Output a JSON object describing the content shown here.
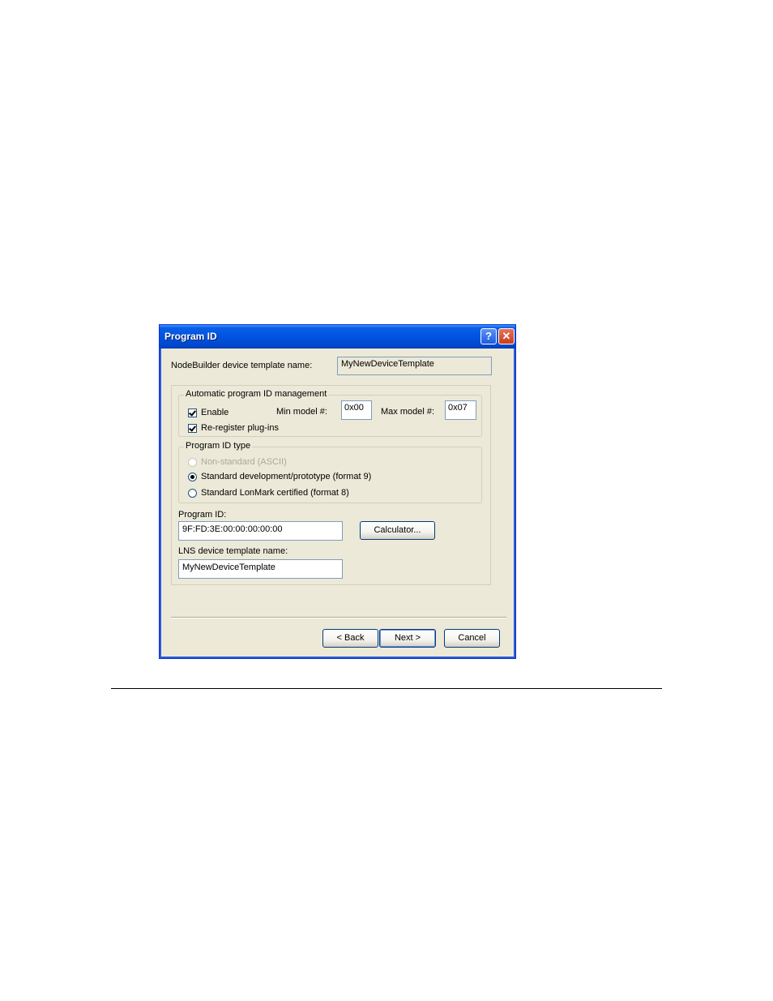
{
  "window": {
    "title": "Program ID",
    "help_glyph": "?",
    "close_glyph": "✕"
  },
  "form": {
    "nodebuilder_label": "NodeBuilder device template name:",
    "nodebuilder_value": "MyNewDeviceTemplate",
    "auto_group": {
      "title": "Automatic program ID management",
      "enable_label": "Enable",
      "enable_checked": true,
      "min_model_label": "Min model #:",
      "min_model_value": "0x00",
      "max_model_label": "Max model #:",
      "max_model_value": "0x07",
      "reregister_label": "Re-register plug-ins",
      "reregister_checked": true
    },
    "type_group": {
      "title": "Program ID type",
      "options": [
        {
          "label": "Non-standard (ASCII)",
          "selected": false,
          "disabled": true
        },
        {
          "label": "Standard development/prototype (format 9)",
          "selected": true,
          "disabled": false
        },
        {
          "label": "Standard LonMark certified (format 8)",
          "selected": false,
          "disabled": false
        }
      ]
    },
    "program_id_label": "Program ID:",
    "program_id_value": "9F:FD:3E:00:00:00:00:00",
    "calculator_label": "Calculator...",
    "lns_label": "LNS device template name:",
    "lns_value": "MyNewDeviceTemplate"
  },
  "buttons": {
    "back": "< Back",
    "next": "Next >",
    "cancel": "Cancel"
  },
  "colors": {
    "titlebar": "#0053E1",
    "dialog_face": "#ECE9D8",
    "field_border": "#7F9DB9"
  }
}
